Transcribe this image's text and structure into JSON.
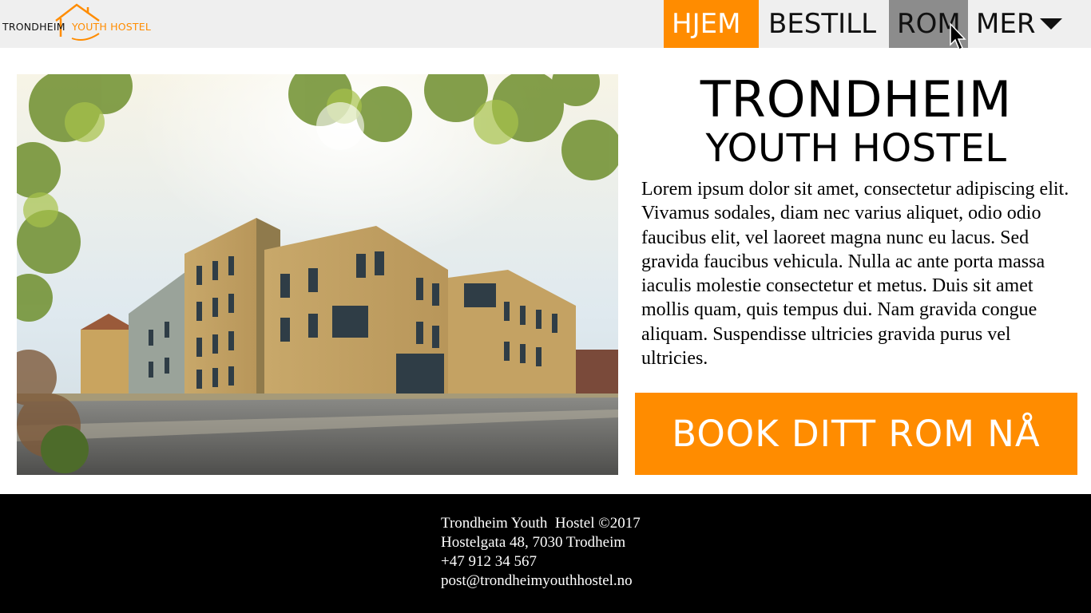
{
  "logo": {
    "text_dark": "TRONDHEIM",
    "text_orange": "YOUTH HOSTEL"
  },
  "nav": {
    "items": [
      {
        "label": "HJEM",
        "state": "active"
      },
      {
        "label": "BESTILL",
        "state": "normal"
      },
      {
        "label": "ROM",
        "state": "hover"
      },
      {
        "label": "MER",
        "state": "dropdown"
      }
    ]
  },
  "main": {
    "title_line1": "TRONDHEIM",
    "title_line2": "YOUTH HOSTEL",
    "body_text": "Lorem ipsum dolor sit amet, consectetur adipiscing elit. Vivamus sodales, diam nec varius aliquet, odio odio faucibus elit, vel laoreet magna nunc eu lacus. Sed gravida faucibus vehicula. Nulla ac ante porta massa iaculis molestie consectetur et metus. Duis sit amet mollis quam, quis tempus dui. Nam gravida congue aliquam. Suspendisse ultricies gravida purus vel ultricies.",
    "book_button": "BOOK DITT ROM NÅ"
  },
  "footer": {
    "line1": "Trondheim Youth  Hostel ©2017",
    "line2": "Hostelgata 48, 7030 Trodheim",
    "line3": "+47 912 34 567",
    "line4": "post@trondheimyouthhostel.no"
  },
  "colors": {
    "accent": "#ff8c00",
    "header_bg": "#efefef",
    "hover_bg": "#8c8c8c",
    "footer_bg": "#000000"
  }
}
